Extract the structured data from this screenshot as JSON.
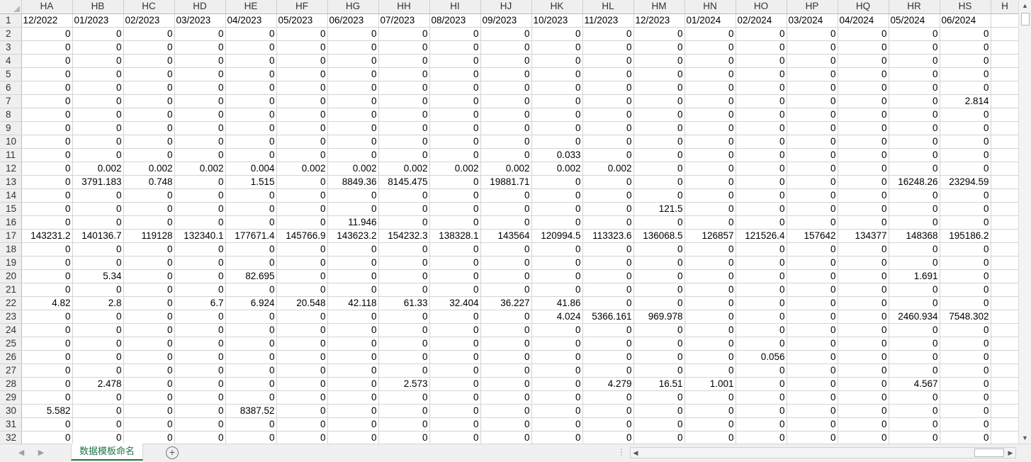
{
  "sheet": {
    "col_headers": [
      "HA",
      "HB",
      "HC",
      "HD",
      "HE",
      "HF",
      "HG",
      "HH",
      "HI",
      "HJ",
      "HK",
      "HL",
      "HM",
      "HN",
      "HO",
      "HP",
      "HQ",
      "HR",
      "HS",
      "H"
    ],
    "header_row": {
      "num": "1",
      "cells": [
        "12/2022",
        "01/2023",
        "02/2023",
        "03/2023",
        "04/2023",
        "05/2023",
        "06/2023",
        "07/2023",
        "08/2023",
        "09/2023",
        "10/2023",
        "11/2023",
        "12/2023",
        "01/2024",
        "02/2024",
        "03/2024",
        "04/2024",
        "05/2024",
        "06/2024",
        ""
      ]
    },
    "rows": [
      {
        "num": "2",
        "cells": [
          "0",
          "0",
          "0",
          "0",
          "0",
          "0",
          "0",
          "0",
          "0",
          "0",
          "0",
          "0",
          "0",
          "0",
          "0",
          "0",
          "0",
          "0",
          "0",
          ""
        ]
      },
      {
        "num": "3",
        "cells": [
          "0",
          "0",
          "0",
          "0",
          "0",
          "0",
          "0",
          "0",
          "0",
          "0",
          "0",
          "0",
          "0",
          "0",
          "0",
          "0",
          "0",
          "0",
          "0",
          ""
        ]
      },
      {
        "num": "4",
        "cells": [
          "0",
          "0",
          "0",
          "0",
          "0",
          "0",
          "0",
          "0",
          "0",
          "0",
          "0",
          "0",
          "0",
          "0",
          "0",
          "0",
          "0",
          "0",
          "0",
          ""
        ]
      },
      {
        "num": "5",
        "cells": [
          "0",
          "0",
          "0",
          "0",
          "0",
          "0",
          "0",
          "0",
          "0",
          "0",
          "0",
          "0",
          "0",
          "0",
          "0",
          "0",
          "0",
          "0",
          "0",
          ""
        ]
      },
      {
        "num": "6",
        "cells": [
          "0",
          "0",
          "0",
          "0",
          "0",
          "0",
          "0",
          "0",
          "0",
          "0",
          "0",
          "0",
          "0",
          "0",
          "0",
          "0",
          "0",
          "0",
          "0",
          ""
        ]
      },
      {
        "num": "7",
        "cells": [
          "0",
          "0",
          "0",
          "0",
          "0",
          "0",
          "0",
          "0",
          "0",
          "0",
          "0",
          "0",
          "0",
          "0",
          "0",
          "0",
          "0",
          "0",
          "2.814",
          ""
        ]
      },
      {
        "num": "8",
        "cells": [
          "0",
          "0",
          "0",
          "0",
          "0",
          "0",
          "0",
          "0",
          "0",
          "0",
          "0",
          "0",
          "0",
          "0",
          "0",
          "0",
          "0",
          "0",
          "0",
          ""
        ]
      },
      {
        "num": "9",
        "cells": [
          "0",
          "0",
          "0",
          "0",
          "0",
          "0",
          "0",
          "0",
          "0",
          "0",
          "0",
          "0",
          "0",
          "0",
          "0",
          "0",
          "0",
          "0",
          "0",
          ""
        ]
      },
      {
        "num": "10",
        "cells": [
          "0",
          "0",
          "0",
          "0",
          "0",
          "0",
          "0",
          "0",
          "0",
          "0",
          "0",
          "0",
          "0",
          "0",
          "0",
          "0",
          "0",
          "0",
          "0",
          ""
        ]
      },
      {
        "num": "11",
        "cells": [
          "0",
          "0",
          "0",
          "0",
          "0",
          "0",
          "0",
          "0",
          "0",
          "0",
          "0.033",
          "0",
          "0",
          "0",
          "0",
          "0",
          "0",
          "0",
          "0",
          ""
        ]
      },
      {
        "num": "12",
        "cells": [
          "0",
          "0.002",
          "0.002",
          "0.002",
          "0.004",
          "0.002",
          "0.002",
          "0.002",
          "0.002",
          "0.002",
          "0.002",
          "0.002",
          "0",
          "0",
          "0",
          "0",
          "0",
          "0",
          "0",
          ""
        ]
      },
      {
        "num": "13",
        "cells": [
          "0",
          "3791.183",
          "0.748",
          "0",
          "1.515",
          "0",
          "8849.36",
          "8145.475",
          "0",
          "19881.71",
          "0",
          "0",
          "0",
          "0",
          "0",
          "0",
          "0",
          "16248.26",
          "23294.59",
          ""
        ]
      },
      {
        "num": "14",
        "cells": [
          "0",
          "0",
          "0",
          "0",
          "0",
          "0",
          "0",
          "0",
          "0",
          "0",
          "0",
          "0",
          "0",
          "0",
          "0",
          "0",
          "0",
          "0",
          "0",
          ""
        ]
      },
      {
        "num": "15",
        "cells": [
          "0",
          "0",
          "0",
          "0",
          "0",
          "0",
          "0",
          "0",
          "0",
          "0",
          "0",
          "0",
          "121.5",
          "0",
          "0",
          "0",
          "0",
          "0",
          "0",
          ""
        ]
      },
      {
        "num": "16",
        "cells": [
          "0",
          "0",
          "0",
          "0",
          "0",
          "0",
          "11.946",
          "0",
          "0",
          "0",
          "0",
          "0",
          "0",
          "0",
          "0",
          "0",
          "0",
          "0",
          "0",
          ""
        ]
      },
      {
        "num": "17",
        "cells": [
          "143231.2",
          "140136.7",
          "119128",
          "132340.1",
          "177671.4",
          "145766.9",
          "143623.2",
          "154232.3",
          "138328.1",
          "143564",
          "120994.5",
          "113323.6",
          "136068.5",
          "126857",
          "121526.4",
          "157642",
          "134377",
          "148368",
          "195186.2",
          ""
        ]
      },
      {
        "num": "18",
        "cells": [
          "0",
          "0",
          "0",
          "0",
          "0",
          "0",
          "0",
          "0",
          "0",
          "0",
          "0",
          "0",
          "0",
          "0",
          "0",
          "0",
          "0",
          "0",
          "0",
          ""
        ]
      },
      {
        "num": "19",
        "cells": [
          "0",
          "0",
          "0",
          "0",
          "0",
          "0",
          "0",
          "0",
          "0",
          "0",
          "0",
          "0",
          "0",
          "0",
          "0",
          "0",
          "0",
          "0",
          "0",
          ""
        ]
      },
      {
        "num": "20",
        "cells": [
          "0",
          "5.34",
          "0",
          "0",
          "82.695",
          "0",
          "0",
          "0",
          "0",
          "0",
          "0",
          "0",
          "0",
          "0",
          "0",
          "0",
          "0",
          "1.691",
          "0",
          ""
        ]
      },
      {
        "num": "21",
        "cells": [
          "0",
          "0",
          "0",
          "0",
          "0",
          "0",
          "0",
          "0",
          "0",
          "0",
          "0",
          "0",
          "0",
          "0",
          "0",
          "0",
          "0",
          "0",
          "0",
          ""
        ]
      },
      {
        "num": "22",
        "cells": [
          "4.82",
          "2.8",
          "0",
          "6.7",
          "6.924",
          "20.548",
          "42.118",
          "61.33",
          "32.404",
          "36.227",
          "41.86",
          "0",
          "0",
          "0",
          "0",
          "0",
          "0",
          "0",
          "0",
          ""
        ]
      },
      {
        "num": "23",
        "cells": [
          "0",
          "0",
          "0",
          "0",
          "0",
          "0",
          "0",
          "0",
          "0",
          "0",
          "4.024",
          "5366.161",
          "969.978",
          "0",
          "0",
          "0",
          "0",
          "2460.934",
          "7548.302",
          ""
        ]
      },
      {
        "num": "24",
        "cells": [
          "0",
          "0",
          "0",
          "0",
          "0",
          "0",
          "0",
          "0",
          "0",
          "0",
          "0",
          "0",
          "0",
          "0",
          "0",
          "0",
          "0",
          "0",
          "0",
          ""
        ]
      },
      {
        "num": "25",
        "cells": [
          "0",
          "0",
          "0",
          "0",
          "0",
          "0",
          "0",
          "0",
          "0",
          "0",
          "0",
          "0",
          "0",
          "0",
          "0",
          "0",
          "0",
          "0",
          "0",
          ""
        ]
      },
      {
        "num": "26",
        "cells": [
          "0",
          "0",
          "0",
          "0",
          "0",
          "0",
          "0",
          "0",
          "0",
          "0",
          "0",
          "0",
          "0",
          "0",
          "0.056",
          "0",
          "0",
          "0",
          "0",
          ""
        ]
      },
      {
        "num": "27",
        "cells": [
          "0",
          "0",
          "0",
          "0",
          "0",
          "0",
          "0",
          "0",
          "0",
          "0",
          "0",
          "0",
          "0",
          "0",
          "0",
          "0",
          "0",
          "0",
          "0",
          ""
        ]
      },
      {
        "num": "28",
        "cells": [
          "0",
          "2.478",
          "0",
          "0",
          "0",
          "0",
          "0",
          "2.573",
          "0",
          "0",
          "0",
          "4.279",
          "16.51",
          "1.001",
          "0",
          "0",
          "0",
          "4.567",
          "0",
          ""
        ]
      },
      {
        "num": "29",
        "cells": [
          "0",
          "0",
          "0",
          "0",
          "0",
          "0",
          "0",
          "0",
          "0",
          "0",
          "0",
          "0",
          "0",
          "0",
          "0",
          "0",
          "0",
          "0",
          "0",
          ""
        ]
      },
      {
        "num": "30",
        "cells": [
          "5.582",
          "0",
          "0",
          "0",
          "8387.52",
          "0",
          "0",
          "0",
          "0",
          "0",
          "0",
          "0",
          "0",
          "0",
          "0",
          "0",
          "0",
          "0",
          "0",
          ""
        ]
      },
      {
        "num": "31",
        "cells": [
          "0",
          "0",
          "0",
          "0",
          "0",
          "0",
          "0",
          "0",
          "0",
          "0",
          "0",
          "0",
          "0",
          "0",
          "0",
          "0",
          "0",
          "0",
          "0",
          ""
        ]
      },
      {
        "num": "32",
        "cells": [
          "0",
          "0",
          "0",
          "0",
          "0",
          "0",
          "0",
          "0",
          "0",
          "0",
          "0",
          "0",
          "0",
          "0",
          "0",
          "0",
          "0",
          "0",
          "0",
          ""
        ]
      }
    ]
  },
  "bottom_bar": {
    "sheet_tab_label": "数据模板命名",
    "add_sheet_icon": "plus-circle-icon",
    "prev_icon": "triangle-left-icon",
    "next_icon": "triangle-right-icon"
  },
  "colors": {
    "accent": "#217346",
    "header_bg": "#efefef",
    "grid_line": "#d4d4d4"
  }
}
